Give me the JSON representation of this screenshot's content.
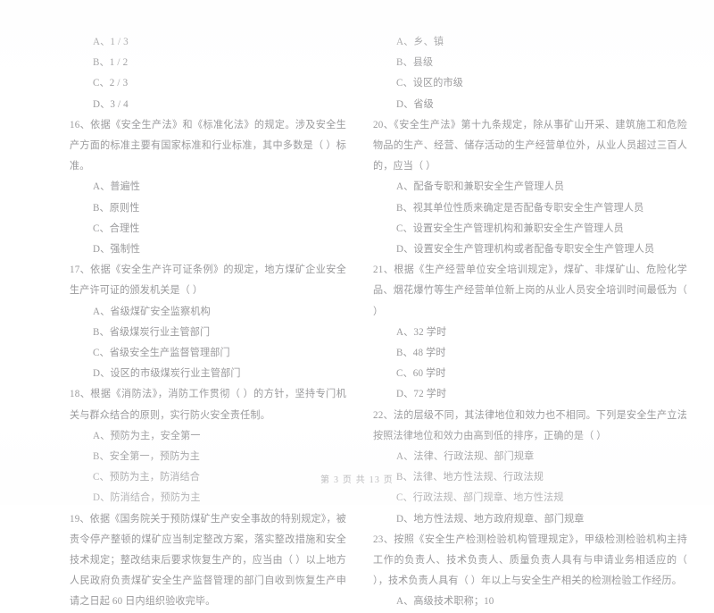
{
  "document": {
    "footer": "第 3 页 共 13 页"
  },
  "left_column": {
    "leading_options": [
      "A、1 / 3",
      "B、1 / 2",
      "C、2 / 3",
      "D、3 / 4"
    ],
    "questions": [
      {
        "number": "16",
        "stem": "16、依据《安全生产法》和《标准化法》的规定。涉及安全生产方面的标准主要有国家标准和行业标准，其中多数是（   ）标准。",
        "options": [
          "A、普遍性",
          "B、原则性",
          "C、合理性",
          "D、强制性"
        ]
      },
      {
        "number": "17",
        "stem": "17、依据《安全生产许可证条例》的规定，地方煤矿企业安全生产许可证的颁发机关是（   ）",
        "options": [
          "A、省级煤矿安全监察机构",
          "B、省级煤炭行业主管部门",
          "C、省级安全生产监督管理部门",
          "D、设区的市级煤炭行业主管部门"
        ]
      },
      {
        "number": "18",
        "stem": "18、根据《消防法》，消防工作贯彻（   ）的方针，坚持专门机关与群众结合的原则，实行防火安全责任制。",
        "options": [
          "A、预防为主，安全第一",
          "B、安全第一，预防为主",
          "C、预防为主，防消结合",
          "D、防消结合，预防为主"
        ]
      },
      {
        "number": "19",
        "stem": "19、依据《国务院关于预防煤矿生产安全事故的特别规定》，被责令停产整顿的煤矿应当制定整改方案，落实整改措施和安全技术规定；整改结束后要求恢复生产的，应当由（   ）以上地方人民政府负责煤矿安全生产监督管理的部门自收到恢复生产申请之日起 60 日内组织验收完毕。",
        "options": []
      }
    ]
  },
  "right_column": {
    "leading_options": [
      "A、乡、镇",
      "B、县级",
      "C、设区的市级",
      "D、省级"
    ],
    "questions": [
      {
        "number": "20",
        "stem": "20、《安全生产法》第十九条规定，除从事矿山开采、建筑施工和危险物品的生产、经营、储存活动的生产经营单位外，从业人员超过三百人的，应当（   ）",
        "options": [
          "A、配备专职和兼职安全生产管理人员",
          "B、视其单位性质来确定是否配备专职安全生产管理人员",
          "C、设置安全生产管理机构和兼职安全生产管理人员",
          "D、设置安全生产管理机构或者配备专职安全生产管理人员"
        ]
      },
      {
        "number": "21",
        "stem": "21、根据《生产经营单位安全培训规定》，煤矿、非煤矿山、危险化学品、烟花爆竹等生产经营单位新上岗的从业人员安全培训时间最低为（   ）",
        "options": [
          "A、32 学时",
          "B、48 学时",
          "C、60 学时",
          "D、72 学时"
        ]
      },
      {
        "number": "22",
        "stem": "22、法的层级不同，其法律地位和效力也不相同。下列是安全生产立法按照法律地位和效力由高到低的排序，正确的是（   ）",
        "options": [
          "A、法律、行政法规、部门规章",
          "B、法律、地方性法规、行政法规",
          "C、行政法规、部门规章、地方性法规",
          "D、地方性法规、地方政府规章、部门规章"
        ]
      },
      {
        "number": "23",
        "stem": "23、按照《安全生产检测检验机构管理规定》，甲级检测检验机构主持工作的负责人、技术负责人、质量负责人具有与申请业务相适应的（   ），技术负责人具有（   ）年以上与安全生产相关的检测检验工作经历。",
        "options": [
          "A、高级技术职称；10"
        ]
      }
    ]
  }
}
